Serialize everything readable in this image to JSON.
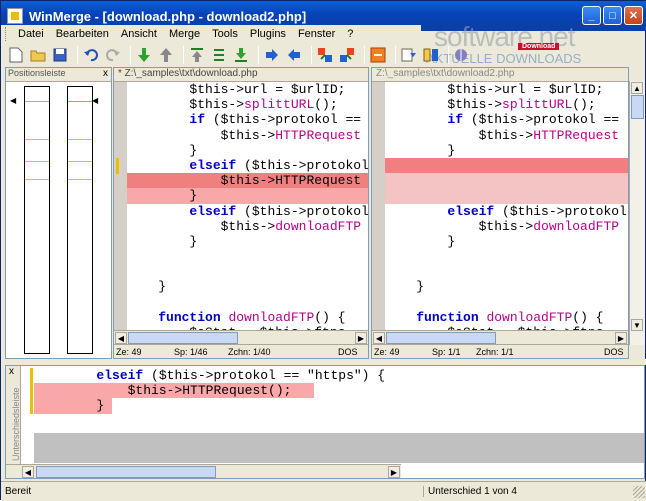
{
  "window": {
    "title": "WinMerge - [download.php - download2.php]",
    "buttons": {
      "minimize": "_",
      "maximize": "□",
      "close": "✕"
    }
  },
  "watermark": {
    "logo": "software.net",
    "badge": "Download",
    "subtitle": "AKTUELLE DOWNLOADS"
  },
  "menu": {
    "items": [
      "Datei",
      "Bearbeiten",
      "Ansicht",
      "Merge",
      "Tools",
      "Plugins",
      "Fenster",
      "?"
    ]
  },
  "toolbar": {
    "icons": [
      "new-icon",
      "open-icon",
      "save-icon",
      "undo-icon",
      "redo-icon",
      "next-diff-icon",
      "prev-diff-icon",
      "first-diff-icon",
      "current-diff-icon",
      "last-diff-icon",
      "copy-right-icon",
      "copy-left-icon",
      "copy-all-right-icon",
      "copy-all-left-icon",
      "options-icon",
      "refresh-icon",
      "compare-icon",
      "help-icon"
    ]
  },
  "location_pane": {
    "title": "Positionsleiste",
    "close": "x"
  },
  "left_pane": {
    "header": "* Z:\\_samples\\txt\\download.php",
    "status": {
      "line": "Ze: 49",
      "col": "Sp: 1/46",
      "chars": "Zchn: 1/40",
      "eol": "DOS"
    }
  },
  "right_pane": {
    "header": "Z:\\_samples\\txt\\download2.php",
    "status": {
      "line": "Ze: 49",
      "col": "Sp: 1/1",
      "chars": "Zchn: 1/1",
      "eol": "DOS"
    }
  },
  "left_code": [
    {
      "indent": "        ",
      "parts": [
        [
          "v",
          "$this->url = $urlID;"
        ]
      ]
    },
    {
      "indent": "        ",
      "parts": [
        [
          "v",
          "$this->"
        ],
        [
          "f",
          "splittURL"
        ],
        [
          "v",
          "();"
        ]
      ]
    },
    {
      "indent": "        ",
      "parts": [
        [
          "k",
          "if"
        ],
        [
          "v",
          " ($this->protokol =="
        ]
      ]
    },
    {
      "indent": "            ",
      "parts": [
        [
          "v",
          "$this->"
        ],
        [
          "f",
          "HTTPRequest"
        ]
      ]
    },
    {
      "indent": "        ",
      "parts": [
        [
          "v",
          "}"
        ]
      ]
    },
    {
      "indent": "        ",
      "parts": [
        [
          "k",
          "elseif"
        ],
        [
          "v",
          " ($this->protokol"
        ]
      ]
    },
    {
      "indent": "            ",
      "parts": [
        [
          "v",
          "$this->HTTPRequest"
        ]
      ]
    },
    {
      "indent": "        ",
      "parts": [
        [
          "v",
          "}"
        ]
      ]
    },
    {
      "indent": "        ",
      "parts": [
        [
          "k",
          "elseif"
        ],
        [
          "v",
          " ($this->protokol"
        ]
      ]
    },
    {
      "indent": "            ",
      "parts": [
        [
          "v",
          "$this->"
        ],
        [
          "f",
          "downloadFTP"
        ]
      ]
    },
    {
      "indent": "        ",
      "parts": [
        [
          "v",
          "}"
        ]
      ]
    },
    {
      "indent": "",
      "parts": [
        [
          "v",
          ""
        ]
      ]
    },
    {
      "indent": "",
      "parts": [
        [
          "v",
          ""
        ]
      ]
    },
    {
      "indent": "    ",
      "parts": [
        [
          "v",
          "}"
        ]
      ]
    },
    {
      "indent": "",
      "parts": [
        [
          "v",
          ""
        ]
      ]
    },
    {
      "indent": "    ",
      "parts": [
        [
          "k",
          "function"
        ],
        [
          "v",
          " "
        ],
        [
          "f",
          "downloadFTP"
        ],
        [
          "v",
          "() {"
        ]
      ]
    },
    {
      "indent": "        ",
      "parts": [
        [
          "v",
          "$aStat = $this->ftpc"
        ]
      ]
    }
  ],
  "right_code": [
    {
      "indent": "        ",
      "parts": [
        [
          "v",
          "$this->url = $urlID;"
        ]
      ]
    },
    {
      "indent": "        ",
      "parts": [
        [
          "v",
          "$this->"
        ],
        [
          "f",
          "splittURL"
        ],
        [
          "v",
          "();"
        ]
      ]
    },
    {
      "indent": "        ",
      "parts": [
        [
          "k",
          "if"
        ],
        [
          "v",
          " ($this->protokol =="
        ]
      ]
    },
    {
      "indent": "            ",
      "parts": [
        [
          "v",
          "$this->"
        ],
        [
          "f",
          "HTTPRequest"
        ]
      ]
    },
    {
      "indent": "        ",
      "parts": [
        [
          "v",
          "}"
        ]
      ]
    },
    {
      "indent": "",
      "parts": [
        [
          "v",
          ""
        ]
      ]
    },
    {
      "indent": "",
      "parts": [
        [
          "v",
          ""
        ]
      ]
    },
    {
      "indent": "",
      "parts": [
        [
          "v",
          ""
        ]
      ]
    },
    {
      "indent": "        ",
      "parts": [
        [
          "k",
          "elseif"
        ],
        [
          "v",
          " ($this->protokol"
        ]
      ]
    },
    {
      "indent": "            ",
      "parts": [
        [
          "v",
          "$this->"
        ],
        [
          "f",
          "downloadFTP"
        ]
      ]
    },
    {
      "indent": "        ",
      "parts": [
        [
          "v",
          "}"
        ]
      ]
    },
    {
      "indent": "",
      "parts": [
        [
          "v",
          ""
        ]
      ]
    },
    {
      "indent": "",
      "parts": [
        [
          "v",
          ""
        ]
      ]
    },
    {
      "indent": "    ",
      "parts": [
        [
          "v",
          "}"
        ]
      ]
    },
    {
      "indent": "",
      "parts": [
        [
          "v",
          ""
        ]
      ]
    },
    {
      "indent": "    ",
      "parts": [
        [
          "k",
          "function"
        ],
        [
          "v",
          " "
        ],
        [
          "f",
          "downloadFTP"
        ],
        [
          "v",
          "() {"
        ]
      ]
    },
    {
      "indent": "        ",
      "parts": [
        [
          "v",
          "$aStat = $this->ftpc"
        ]
      ]
    }
  ],
  "diff_pane": {
    "side_label": "Unterschiedsleiste",
    "close": "x",
    "lines": [
      {
        "indent": "        ",
        "parts": [
          [
            "k",
            "elseif"
          ],
          [
            "v",
            " ($this->protokol == \"https\") {"
          ]
        ]
      },
      {
        "indent": "            ",
        "parts": [
          [
            "v",
            "$this->HTTPRequest();"
          ]
        ]
      },
      {
        "indent": "        ",
        "parts": [
          [
            "v",
            "}"
          ]
        ]
      }
    ]
  },
  "status": {
    "left": "Bereit",
    "right": "Unterschied 1 von 4"
  },
  "colors": {
    "diff": "#f8a8a8",
    "diff_selected": "#f08080",
    "diff_empty": "#f4c4c4",
    "keyword": "#0000c0",
    "function": "#b8008a",
    "titlebar": "#0842b6"
  }
}
